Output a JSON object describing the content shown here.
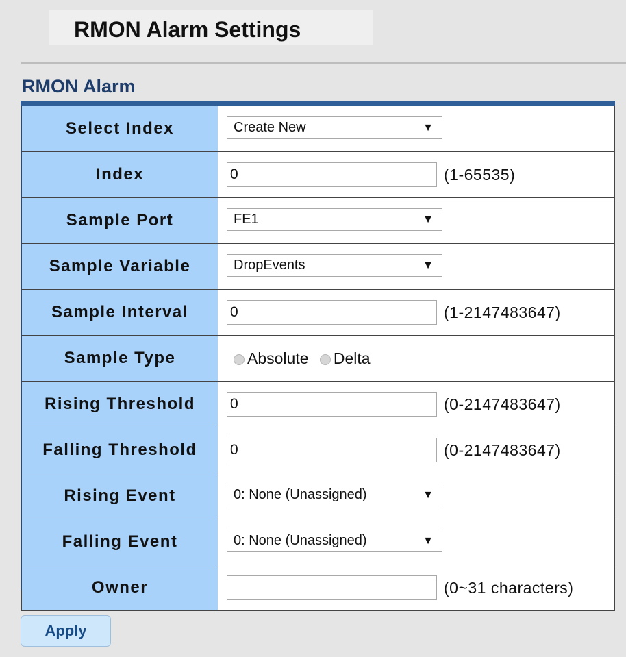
{
  "page": {
    "title": "RMON Alarm Settings",
    "section_title": "RMON Alarm"
  },
  "form": {
    "rows": [
      {
        "label": "Select Index",
        "type": "select",
        "value": "Create New"
      },
      {
        "label": "Index",
        "type": "input",
        "value": "0",
        "hint": "(1-65535)"
      },
      {
        "label": "Sample Port",
        "type": "select",
        "value": "FE1"
      },
      {
        "label": "Sample Variable",
        "type": "select",
        "value": "DropEvents"
      },
      {
        "label": "Sample Interval",
        "type": "input",
        "value": "0",
        "hint": "(1-2147483647)"
      },
      {
        "label": "Sample Type",
        "type": "radio",
        "options": [
          "Absolute",
          "Delta"
        ]
      },
      {
        "label": "Rising Threshold",
        "type": "input",
        "value": "0",
        "hint": "(0-2147483647)"
      },
      {
        "label": "Falling Threshold",
        "type": "input",
        "value": "0",
        "hint": "(0-2147483647)"
      },
      {
        "label": "Rising Event",
        "type": "select",
        "value": "0: None (Unassigned)"
      },
      {
        "label": "Falling Event",
        "type": "select",
        "value": "0: None (Unassigned)"
      },
      {
        "label": "Owner",
        "type": "input",
        "value": "",
        "hint": "(0~31 characters)"
      }
    ]
  },
  "actions": {
    "apply_label": "Apply"
  },
  "colors": {
    "label_bg": "#a8d2fa",
    "frame": "#2f5f96",
    "section_title": "#1f3d6b",
    "button_text": "#174b86"
  }
}
